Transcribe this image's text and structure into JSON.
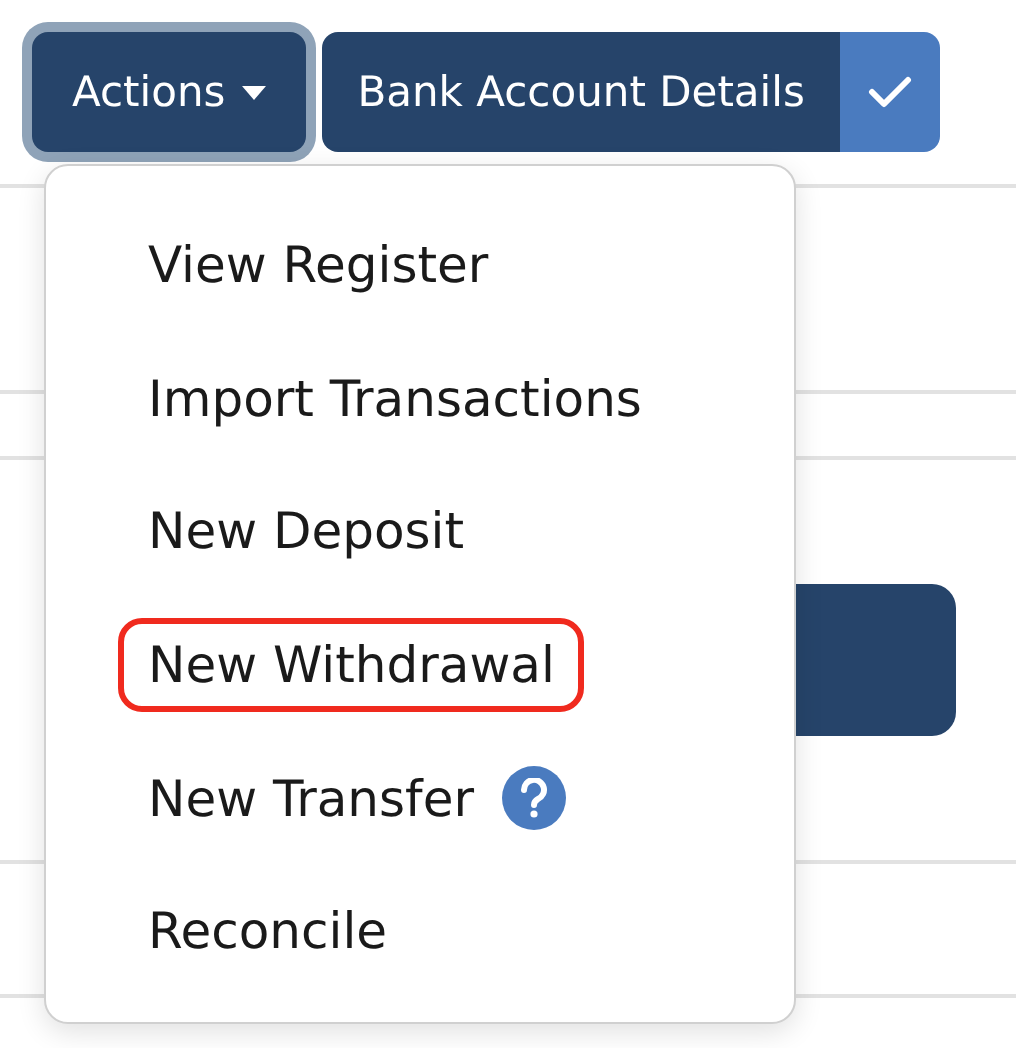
{
  "toolbar": {
    "actions_button": {
      "label": "Actions",
      "expanded": true
    },
    "details_button": {
      "label": "Bank Account Details",
      "checked": true
    }
  },
  "actions_menu": {
    "items": [
      {
        "label": "View Register",
        "highlighted": false,
        "help": false
      },
      {
        "label": "Import Transactions",
        "highlighted": false,
        "help": false
      },
      {
        "label": "New Deposit",
        "highlighted": false,
        "help": false
      },
      {
        "label": "New Withdrawal",
        "highlighted": true,
        "help": false
      },
      {
        "label": "New Transfer",
        "highlighted": false,
        "help": true
      },
      {
        "label": "Reconcile",
        "highlighted": false,
        "help": false
      }
    ]
  }
}
